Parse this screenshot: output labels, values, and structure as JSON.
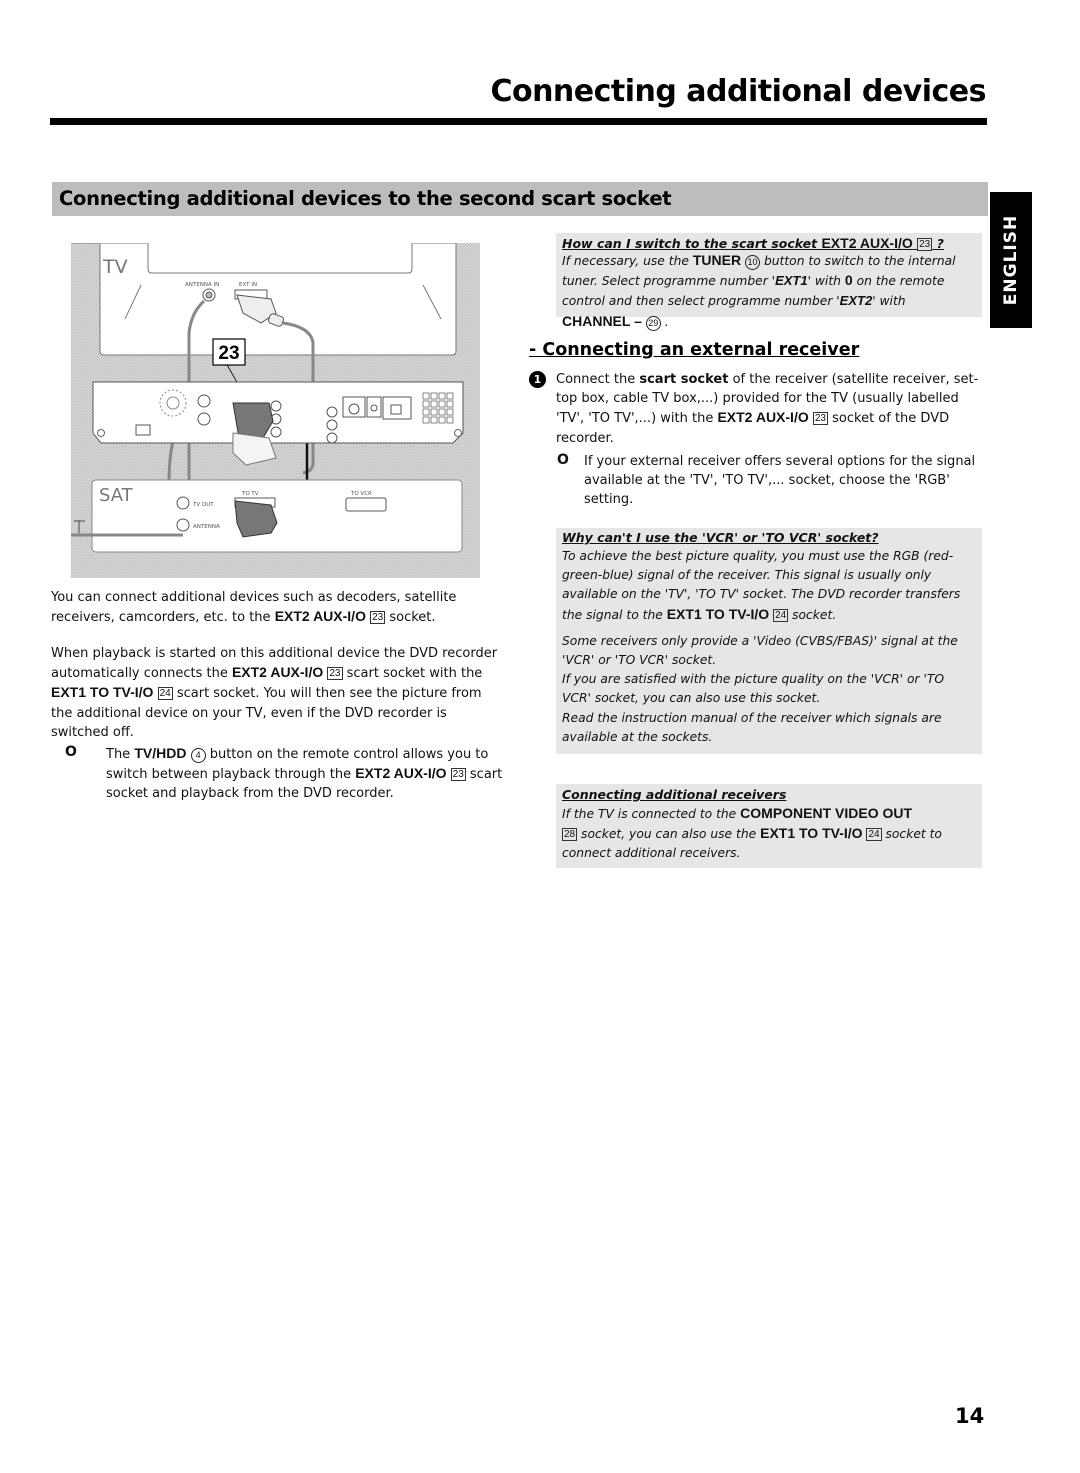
{
  "header": {
    "title": "Connecting additional devices"
  },
  "section": {
    "title": "Connecting additional devices to the second scart socket"
  },
  "language_tab": "ENGLISH",
  "diagram": {
    "tv_label": "TV",
    "tv_antenna_in": "ANTENNA IN",
    "tv_ext_in": "EXT IN",
    "callout": "23",
    "sat_label": "SAT",
    "sat_tv_out": "TV OUT",
    "sat_antenna": "ANTENNA",
    "sat_to_tv": "TO TV",
    "sat_to_vcr": "TO VCR"
  },
  "left": {
    "para1": {
      "t1": "You can connect additional devices such as decoders, satellite receivers, camcorders, etc. to the ",
      "b1": "EXT2 AUX-I/O",
      "k1": "23",
      "t2": " socket."
    },
    "para2": {
      "t1": "When playback is started on this additional device the DVD recorder automatically connects the ",
      "b1": "EXT2 AUX-I/O",
      "k1": "23",
      "t2": " scart socket with the ",
      "b2": "EXT1 TO TV-I/O",
      "k2": "24",
      "t3": " scart socket. You will then see the picture from the additional device on your TV, even if the DVD recorder is switched off."
    },
    "tip": {
      "bullet": "O",
      "t1": "The ",
      "b1": "TV/HDD",
      "c1": "4",
      "t2": " button on the remote control allows you to switch between playback through the ",
      "b2": "EXT2 AUX-I/O",
      "k1": "23",
      "t3": " scart socket and playback from the DVD recorder."
    }
  },
  "faq_switch": {
    "question": "How can I switch to the scart socket ",
    "q_bold": "EXT2 AUX-I/O",
    "q_key": "23",
    "q_end": " ?",
    "t1": "If necessary, use the ",
    "b1": "TUNER",
    "c1": "10",
    "t2": " button to switch to the internal tuner. Select programme number '",
    "b2": "EXT1",
    "t3": "' with ",
    "b3": "0",
    "t4": " on the remote control and then select programme number '",
    "b4": "EXT2",
    "t5": "' with ",
    "b5": "CHANNEL –",
    "c2": "29",
    "t6": " ."
  },
  "external_receiver": {
    "heading": "- Connecting an external receiver",
    "step_number": "1",
    "step": {
      "t1": "Connect the ",
      "b1": "scart socket",
      "t2": " of the receiver (satellite receiver, set-top box, cable TV box,...) provided for the TV (usually labelled 'TV', 'TO TV',...) with the ",
      "b2": "EXT2 AUX-I/O",
      "k1": "23",
      "t3": " socket of the DVD recorder."
    },
    "note": {
      "bullet": "O",
      "text": "If your external receiver offers several options for the signal available at the 'TV', 'TO TV',... socket, choose the 'RGB' setting."
    }
  },
  "faq_vcr": {
    "question": "Why can't I use the 'VCR' or 'TO VCR' socket?",
    "p1_t1": "To achieve the best picture quality, you must use the RGB (red-green-blue) signal of the receiver. This signal is usually only available on the 'TV', 'TO TV' socket. The DVD recorder transfers the signal to the ",
    "p1_b1": "EXT1 TO TV-I/O",
    "p1_k1": "24",
    "p1_t2": " socket.",
    "p2": "Some receivers only provide a 'Video (CVBS/FBAS)' signal at the 'VCR' or 'TO VCR' socket.",
    "p3": "If you are satisfied with the picture quality on the 'VCR' or 'TO VCR' socket, you can also use this socket.",
    "p4": "Read the instruction manual of the receiver which signals are available at the sockets."
  },
  "faq_receivers": {
    "question": "Connecting additional receivers",
    "t1": "If the TV is connected to the ",
    "b1": "COMPONENT VIDEO OUT",
    "k1": "28",
    "t2": " socket, you can also use the ",
    "b2": "EXT1 TO TV-I/O",
    "k2": "24",
    "t3": " socket to connect additional receivers."
  },
  "footer": {
    "page_number": "14"
  }
}
